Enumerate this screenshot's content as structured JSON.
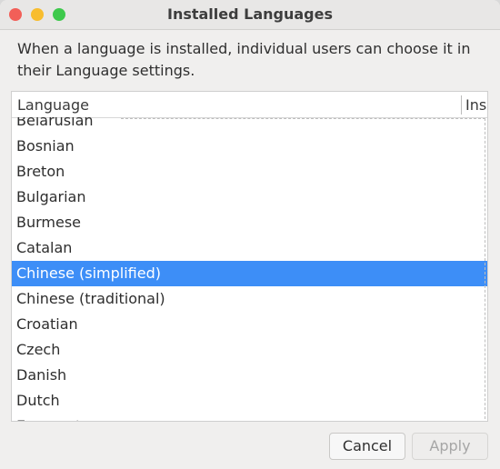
{
  "window": {
    "title": "Installed Languages",
    "description": "When a language is installed, individual users can choose it in their Language settings."
  },
  "table": {
    "columns": [
      "Language",
      "Ins"
    ],
    "rows": [
      "Belarusian",
      "Bosnian",
      "Breton",
      "Bulgarian",
      "Burmese",
      "Catalan",
      "Chinese (simplified)",
      "Chinese (traditional)",
      "Croatian",
      "Czech",
      "Danish",
      "Dutch",
      "Esperanto"
    ],
    "selected_row": "Chinese (simplified)"
  },
  "buttons": {
    "cancel": "Cancel",
    "apply": "Apply"
  },
  "colors": {
    "selection": "#3d8ef7",
    "close": "#f25f58",
    "minimize": "#f8bd2e",
    "maximize": "#3ec94c"
  }
}
